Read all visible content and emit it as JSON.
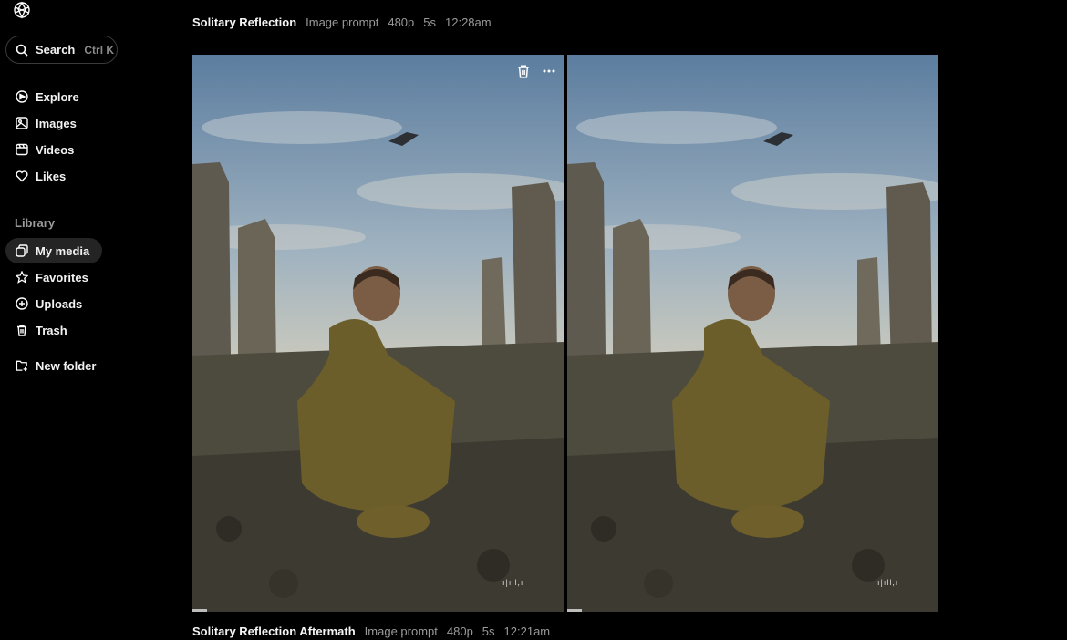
{
  "sidebar": {
    "search": {
      "label": "Search",
      "shortcut": "Ctrl K"
    },
    "nav": [
      {
        "label": "Explore",
        "icon": "compass-icon"
      },
      {
        "label": "Images",
        "icon": "image-icon"
      },
      {
        "label": "Videos",
        "icon": "video-icon"
      },
      {
        "label": "Likes",
        "icon": "heart-icon"
      }
    ],
    "library_label": "Library",
    "library": [
      {
        "label": "My media",
        "icon": "media-icon",
        "active": true
      },
      {
        "label": "Favorites",
        "icon": "star-icon"
      },
      {
        "label": "Uploads",
        "icon": "plus-circle-icon"
      },
      {
        "label": "Trash",
        "icon": "trash-icon"
      }
    ],
    "new_folder": {
      "label": "New folder",
      "icon": "folder-plus-icon"
    }
  },
  "items": [
    {
      "title": "Solitary Reflection",
      "kind": "Image prompt",
      "resolution": "480p",
      "duration": "5s",
      "time": "12:28am"
    },
    {
      "title": "Solitary Reflection Aftermath",
      "kind": "Image prompt",
      "resolution": "480p",
      "duration": "5s",
      "time": "12:21am"
    }
  ],
  "watermark": "··ı|ıll,ı",
  "colors": {
    "background": "#000000",
    "active_nav": "#242424",
    "muted": "#9a9a9a"
  }
}
